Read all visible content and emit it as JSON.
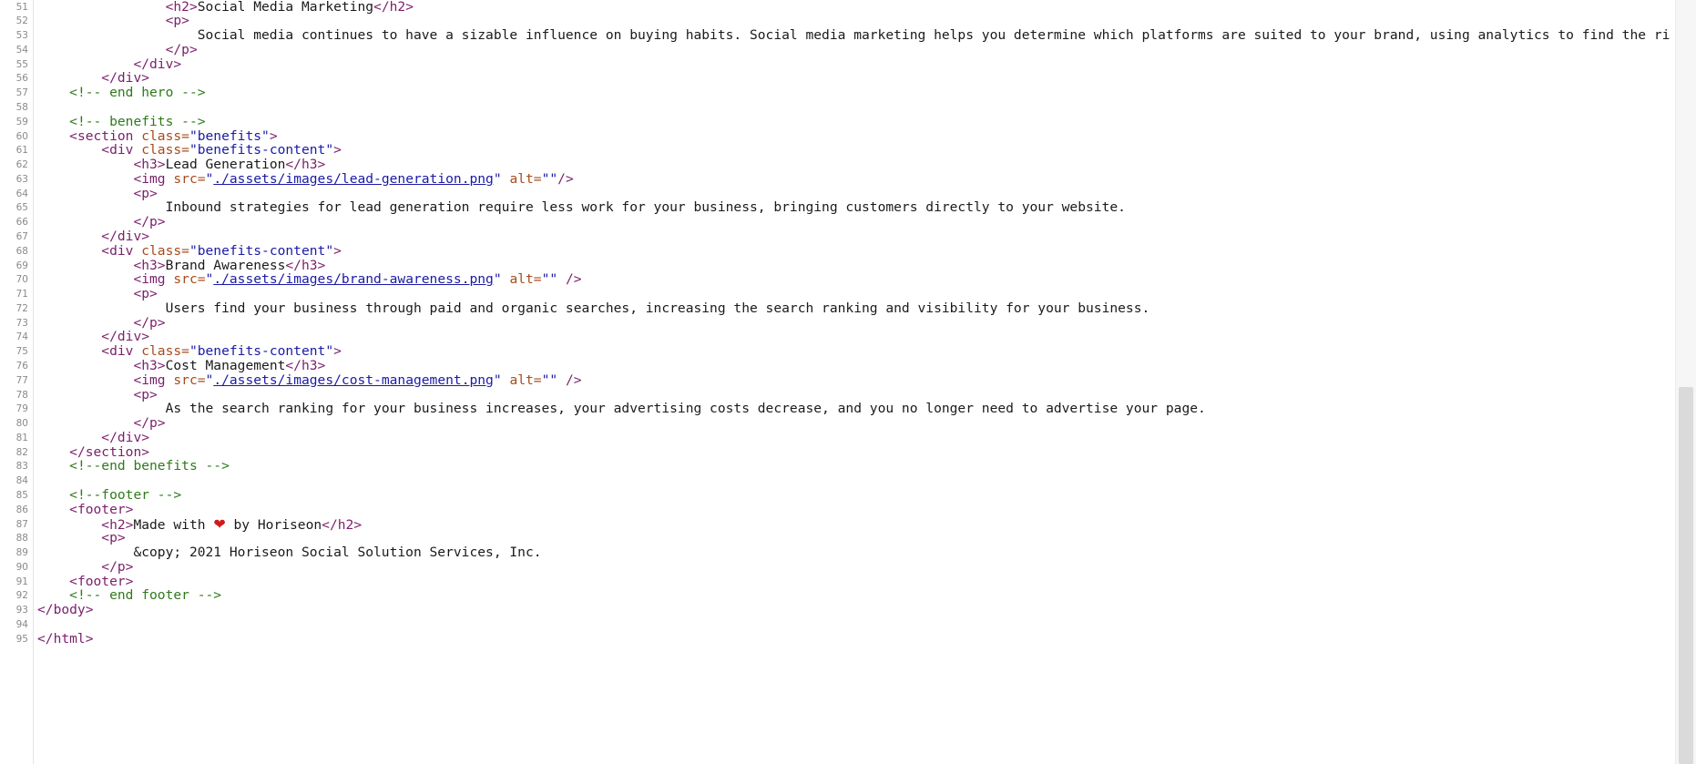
{
  "editor": {
    "line_numbers": [
      "51",
      "52",
      "53",
      "54",
      "55",
      "56",
      "57",
      "58",
      "59",
      "60",
      "61",
      "62",
      "63",
      "64",
      "65",
      "66",
      "67",
      "68",
      "69",
      "70",
      "71",
      "72",
      "73",
      "74",
      "75",
      "76",
      "77",
      "78",
      "79",
      "80",
      "81",
      "82",
      "83",
      "84",
      "85",
      "86",
      "87",
      "88",
      "89",
      "90",
      "91",
      "92",
      "93",
      "94",
      "95"
    ],
    "lines": [
      {
        "indent": "                ",
        "tokens": [
          [
            "tag",
            "<h2>"
          ],
          [
            "text",
            "Social Media Marketing"
          ],
          [
            "tag",
            "</h2>"
          ]
        ]
      },
      {
        "indent": "                ",
        "tokens": [
          [
            "tag",
            "<p>"
          ]
        ]
      },
      {
        "indent": "                    ",
        "tokens": [
          [
            "text",
            "Social media continues to have a sizable influence on buying habits. Social media marketing helps you determine which platforms are suited to your brand, using analytics to find the ri"
          ]
        ]
      },
      {
        "indent": "                ",
        "tokens": [
          [
            "tag",
            "</p>"
          ]
        ]
      },
      {
        "indent": "            ",
        "tokens": [
          [
            "tag",
            "</div>"
          ]
        ]
      },
      {
        "indent": "        ",
        "tokens": [
          [
            "tag",
            "</div>"
          ]
        ]
      },
      {
        "indent": "    ",
        "tokens": [
          [
            "comment",
            "<!-- end hero -->"
          ]
        ]
      },
      {
        "indent": "",
        "tokens": []
      },
      {
        "indent": "    ",
        "tokens": [
          [
            "comment",
            "<!-- benefits -->"
          ]
        ]
      },
      {
        "indent": "    ",
        "tokens": [
          [
            "tag",
            "<section "
          ],
          [
            "attr",
            "class="
          ],
          [
            "str",
            "\"benefits\""
          ],
          [
            "tag",
            ">"
          ]
        ]
      },
      {
        "indent": "        ",
        "tokens": [
          [
            "tag",
            "<div "
          ],
          [
            "attr",
            "class="
          ],
          [
            "str",
            "\"benefits-content\""
          ],
          [
            "tag",
            ">"
          ]
        ]
      },
      {
        "indent": "            ",
        "tokens": [
          [
            "tag",
            "<h3>"
          ],
          [
            "text",
            "Lead Generation"
          ],
          [
            "tag",
            "</h3>"
          ]
        ]
      },
      {
        "indent": "            ",
        "tokens": [
          [
            "tag",
            "<img "
          ],
          [
            "attr",
            "src="
          ],
          [
            "str",
            "\""
          ],
          [
            "link",
            "./assets/images/lead-generation.png"
          ],
          [
            "str",
            "\""
          ],
          [
            "attr",
            " alt="
          ],
          [
            "str",
            "\"\""
          ],
          [
            "tag",
            "/>"
          ]
        ]
      },
      {
        "indent": "            ",
        "tokens": [
          [
            "tag",
            "<p>"
          ]
        ]
      },
      {
        "indent": "                ",
        "tokens": [
          [
            "text",
            "Inbound strategies for lead generation require less work for your business, bringing customers directly to your website."
          ]
        ]
      },
      {
        "indent": "            ",
        "tokens": [
          [
            "tag",
            "</p>"
          ]
        ]
      },
      {
        "indent": "        ",
        "tokens": [
          [
            "tag",
            "</div>"
          ]
        ]
      },
      {
        "indent": "        ",
        "tokens": [
          [
            "tag",
            "<div "
          ],
          [
            "attr",
            "class="
          ],
          [
            "str",
            "\"benefits-content\""
          ],
          [
            "tag",
            ">"
          ]
        ]
      },
      {
        "indent": "            ",
        "tokens": [
          [
            "tag",
            "<h3>"
          ],
          [
            "text",
            "Brand Awareness"
          ],
          [
            "tag",
            "</h3>"
          ]
        ]
      },
      {
        "indent": "            ",
        "tokens": [
          [
            "tag",
            "<img "
          ],
          [
            "attr",
            "src="
          ],
          [
            "str",
            "\""
          ],
          [
            "link",
            "./assets/images/brand-awareness.png"
          ],
          [
            "str",
            "\""
          ],
          [
            "attr",
            " alt="
          ],
          [
            "str",
            "\"\""
          ],
          [
            "tag",
            " />"
          ]
        ]
      },
      {
        "indent": "            ",
        "tokens": [
          [
            "tag",
            "<p>"
          ]
        ]
      },
      {
        "indent": "                ",
        "tokens": [
          [
            "text",
            "Users find your business through paid and organic searches, increasing the search ranking and visibility for your business."
          ]
        ]
      },
      {
        "indent": "            ",
        "tokens": [
          [
            "tag",
            "</p>"
          ]
        ]
      },
      {
        "indent": "        ",
        "tokens": [
          [
            "tag",
            "</div>"
          ]
        ]
      },
      {
        "indent": "        ",
        "tokens": [
          [
            "tag",
            "<div "
          ],
          [
            "attr",
            "class="
          ],
          [
            "str",
            "\"benefits-content\""
          ],
          [
            "tag",
            ">"
          ]
        ]
      },
      {
        "indent": "            ",
        "tokens": [
          [
            "tag",
            "<h3>"
          ],
          [
            "text",
            "Cost Management"
          ],
          [
            "tag",
            "</h3>"
          ]
        ]
      },
      {
        "indent": "            ",
        "tokens": [
          [
            "tag",
            "<img "
          ],
          [
            "attr",
            "src="
          ],
          [
            "str",
            "\""
          ],
          [
            "link",
            "./assets/images/cost-management.png"
          ],
          [
            "str",
            "\""
          ],
          [
            "attr",
            " alt="
          ],
          [
            "str",
            "\"\""
          ],
          [
            "tag",
            " />"
          ]
        ]
      },
      {
        "indent": "            ",
        "tokens": [
          [
            "tag",
            "<p>"
          ]
        ]
      },
      {
        "indent": "                ",
        "tokens": [
          [
            "text",
            "As the search ranking for your business increases, your advertising costs decrease, and you no longer need to advertise your page."
          ]
        ]
      },
      {
        "indent": "            ",
        "tokens": [
          [
            "tag",
            "</p>"
          ]
        ]
      },
      {
        "indent": "        ",
        "tokens": [
          [
            "tag",
            "</div>"
          ]
        ]
      },
      {
        "indent": "    ",
        "tokens": [
          [
            "tag",
            "</section>"
          ]
        ]
      },
      {
        "indent": "    ",
        "tokens": [
          [
            "comment",
            "<!--end benefits -->"
          ]
        ]
      },
      {
        "indent": "",
        "tokens": []
      },
      {
        "indent": "    ",
        "tokens": [
          [
            "comment",
            "<!--footer -->"
          ]
        ]
      },
      {
        "indent": "    ",
        "tokens": [
          [
            "tag",
            "<footer>"
          ]
        ]
      },
      {
        "indent": "        ",
        "tokens": [
          [
            "tag",
            "<h2>"
          ],
          [
            "text",
            "Made with "
          ],
          [
            "heart",
            "❤"
          ],
          [
            "text",
            " by Horiseon"
          ],
          [
            "tag",
            "</h2>"
          ]
        ]
      },
      {
        "indent": "        ",
        "tokens": [
          [
            "tag",
            "<p>"
          ]
        ]
      },
      {
        "indent": "            ",
        "tokens": [
          [
            "text",
            "&copy; 2021 Horiseon Social Solution Services, Inc."
          ]
        ]
      },
      {
        "indent": "        ",
        "tokens": [
          [
            "tag",
            "</p>"
          ]
        ]
      },
      {
        "indent": "    ",
        "tokens": [
          [
            "tag",
            "<footer>"
          ]
        ]
      },
      {
        "indent": "    ",
        "tokens": [
          [
            "comment",
            "<!-- end footer -->"
          ]
        ]
      },
      {
        "indent": "",
        "tokens": [
          [
            "tag",
            "</body>"
          ]
        ]
      },
      {
        "indent": "",
        "tokens": []
      },
      {
        "indent": "",
        "tokens": [
          [
            "tag",
            "</html>"
          ]
        ]
      }
    ]
  },
  "colors": {
    "tag": "#7a1f6b",
    "attribute": "#a84a1a",
    "string": "#1a1aa6",
    "comment": "#2e7a1a",
    "heart": "#d01a1a"
  }
}
